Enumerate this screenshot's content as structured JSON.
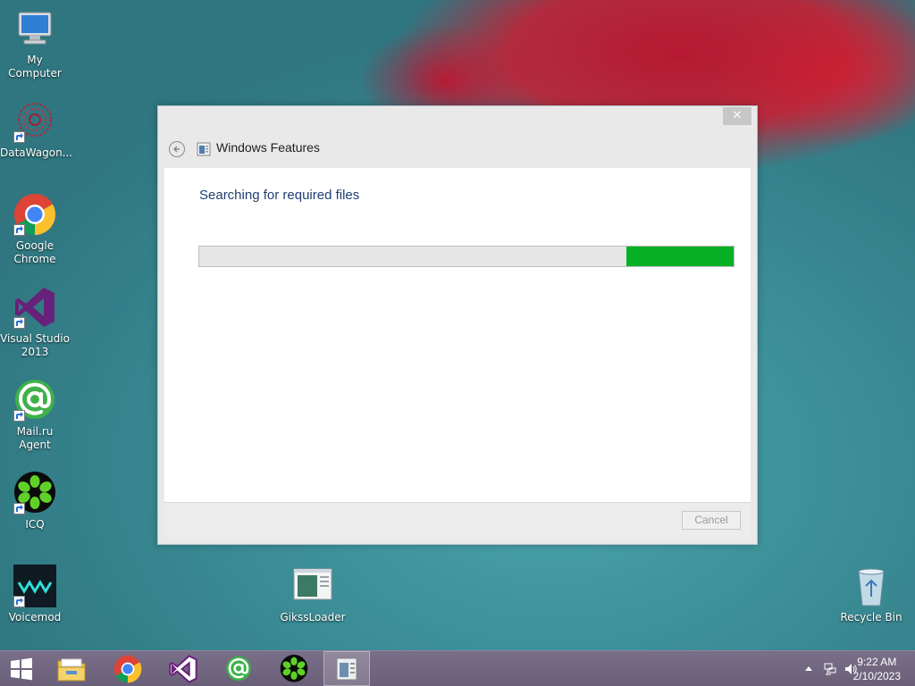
{
  "desktop": {
    "icons": [
      {
        "label": "My Computer",
        "icon": "computer-icon"
      },
      {
        "label": "DataWagon...",
        "icon": "datawagon-icon"
      },
      {
        "label": "Google Chrome",
        "icon": "chrome-icon"
      },
      {
        "label": "Visual Studio 2013",
        "icon": "visual-studio-icon"
      },
      {
        "label": "Mail.ru Agent",
        "icon": "mailru-agent-icon"
      },
      {
        "label": "ICQ",
        "icon": "icq-icon"
      },
      {
        "label": "Voicemod",
        "icon": "voicemod-icon"
      },
      {
        "label": "GikssLoader",
        "icon": "application-icon"
      },
      {
        "label": "Recycle Bin",
        "icon": "recycle-bin-icon"
      }
    ]
  },
  "dialog": {
    "title": "Windows Features",
    "close_glyph": "✕",
    "status": "Searching for required files",
    "progress": {
      "fill_start_fraction": 0.8,
      "fill_end_fraction": 1.0,
      "color": "#06b025"
    },
    "cancel_label": "Cancel"
  },
  "taskbar": {
    "pinned": [
      "start-icon",
      "file-explorer-icon",
      "chrome-icon",
      "visual-studio-icon",
      "mailru-agent-icon",
      "icq-icon",
      "windows-features-icon"
    ],
    "clock": {
      "time": "9:22 AM",
      "date": "2/10/2023"
    }
  },
  "colors": {
    "progress_green": "#06b025",
    "status_text": "#1f3f72",
    "taskbar": "#6f6480"
  }
}
